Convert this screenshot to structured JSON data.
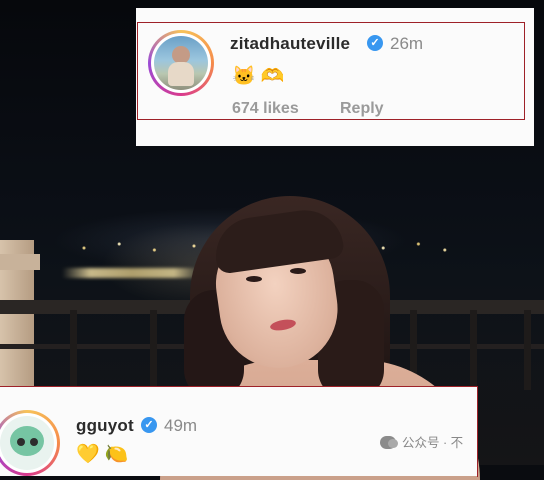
{
  "comments": [
    {
      "username": "zitadhauteville",
      "verified": true,
      "time": "26m",
      "emojis": "🐱 🫶",
      "likes": "674 likes",
      "reply": "Reply"
    },
    {
      "username": "gguyot",
      "verified": true,
      "time": "49m",
      "emojis": "💛 🍋"
    }
  ],
  "verified_mark": "✓",
  "watermark": {
    "text": "公众号 · 不"
  },
  "colors": {
    "verified_blue": "#3897f0",
    "highlight_border": "#9e2128",
    "ring_gradient": [
      "#f7c35a",
      "#f58b4a",
      "#d9398d",
      "#9a4bd6"
    ]
  },
  "icons": [
    "verified-badge-icon",
    "wechat-icon"
  ]
}
